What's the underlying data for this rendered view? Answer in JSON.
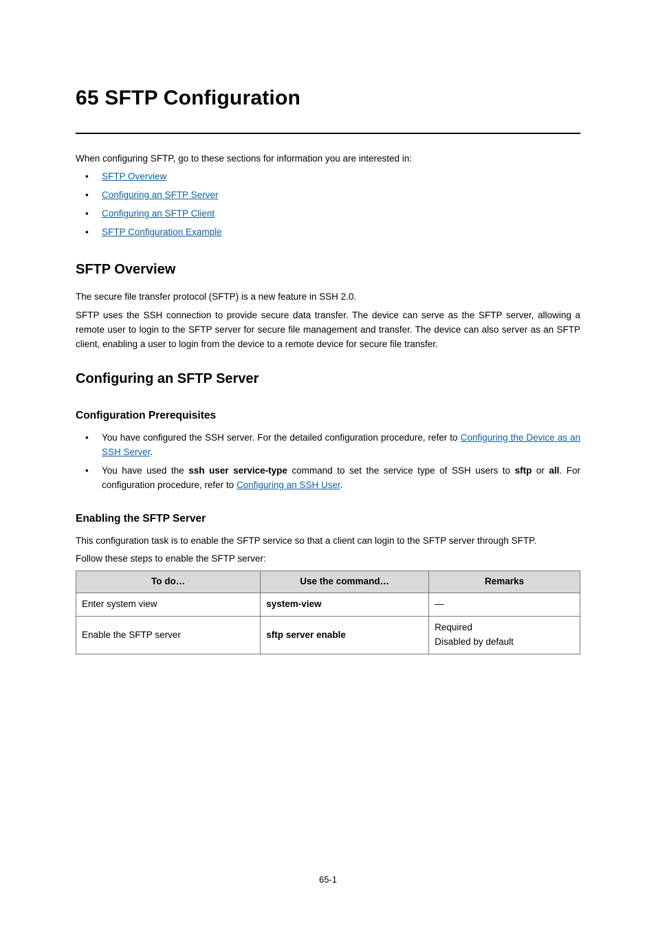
{
  "h1": "65 SFTP Configuration",
  "intro": "When configuring SFTP, go to these sections for information you are interested in:",
  "toc": [
    "SFTP Overview",
    "Configuring an SFTP Server",
    "Configuring an SFTP Client",
    "SFTP Configuration Example"
  ],
  "sec_overview": {
    "heading": "SFTP Overview",
    "p1": "The secure file transfer protocol (SFTP) is a new feature in SSH 2.0.",
    "p2": "SFTP uses the SSH connection to provide secure data transfer. The device can serve as the SFTP server, allowing a remote user to login to the SFTP server for secure file management and transfer. The device can also server as an SFTP client, enabling a user to login from the device to a remote device for secure file transfer."
  },
  "sec_server": {
    "heading": "Configuring an SFTP Server",
    "sub_prereq": "Configuration Prerequisites",
    "b1_pre": "You have configured the SSH server. For the detailed configuration procedure, refer to ",
    "b1_link": "Configuring the Device as an SSH Server",
    "b1_post": ".",
    "b2_pre": "You have used the ",
    "b2_cmd": "ssh user service-type",
    "b2_mid": " command to set the service type of SSH users to ",
    "b2_kw1": "sftp",
    "b2_or": " or ",
    "b2_kw2": "all",
    "b2_post1": ". For configuration procedure, refer to ",
    "b2_link": "Configuring an SSH User",
    "b2_post2": ".",
    "sub_enable": "Enabling the SFTP Server",
    "enable_p1": "This configuration task is to enable the SFTP service so that a client can login to the SFTP server through SFTP.",
    "enable_p2": "Follow these steps to enable the SFTP server:"
  },
  "table": {
    "headers": {
      "c1": "To do…",
      "c2": "Use the command…",
      "c3": "Remarks"
    },
    "rows": [
      {
        "c1": "Enter system view",
        "c2": "system-view",
        "c3": "—"
      },
      {
        "c1": "Enable the SFTP server",
        "c2": "sftp server enable",
        "c3": "Required\nDisabled by default"
      }
    ]
  },
  "footer": "65-1"
}
